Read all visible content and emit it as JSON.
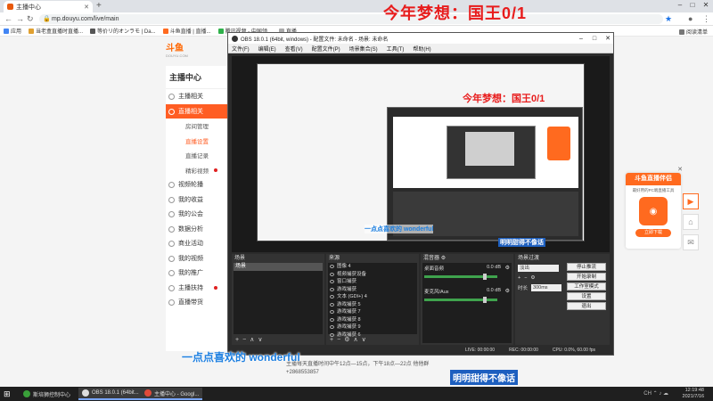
{
  "browser": {
    "tab_title": "主播中心",
    "address": "mp.douyu.com/live/main",
    "bookmarks": [
      "应用",
      "当老盒直播时直播...",
      "等价リ的オンラモ | Da...",
      "斗鱼直播 | 直播...",
      "腾讯视频 - 中国领...",
      "直播..."
    ],
    "bookmarks_right": "阅读清单"
  },
  "overlay_top": "今年梦想：国王0/1",
  "douyu": {
    "logo_text": "斗鱼",
    "logo_sub": "DOUYU.COM",
    "sidebar_title": "主播中心",
    "sidebar_items": [
      {
        "label": "主播相关",
        "type": "item"
      },
      {
        "label": "直播相关",
        "type": "active"
      },
      {
        "label": "房间管理",
        "type": "sub"
      },
      {
        "label": "直播设置",
        "type": "sub-red"
      },
      {
        "label": "直播记录",
        "type": "sub"
      },
      {
        "label": "精彩视频",
        "type": "sub-dot"
      },
      {
        "label": "视频轮播",
        "type": "item"
      },
      {
        "label": "我的收益",
        "type": "item"
      },
      {
        "label": "我的公会",
        "type": "item"
      },
      {
        "label": "数据分析",
        "type": "item"
      },
      {
        "label": "商业活动",
        "type": "item"
      },
      {
        "label": "我的视频",
        "type": "item"
      },
      {
        "label": "我的推广",
        "type": "item"
      },
      {
        "label": "主播扶持",
        "type": "item-dot"
      },
      {
        "label": "直播带货",
        "type": "item"
      }
    ],
    "bottom_text": "主播每天直播时间中午12点—15点，下午18点—22点 他他群+2868553857"
  },
  "promo": {
    "title": "斗鱼直播伴侣",
    "desc": "最好用的PC端直播工具",
    "button": "立即下载"
  },
  "obs": {
    "title": "OBS 18.0.1 (64bit, windows) - 配置文件: 未命名 - 场景: 未命名",
    "menu": [
      "文件(F)",
      "编辑(E)",
      "查看(V)",
      "配置文件(P)",
      "场景集合(S)",
      "工具(T)",
      "帮助(H)"
    ],
    "nested_overlay": "今年梦想：国王0/1",
    "nested_sub1": "一点点喜欢的 wonderful",
    "nested_sub2": "明明甜得不像话",
    "scenes_title": "场景",
    "scenes": [
      "场景"
    ],
    "sources_title": "来源",
    "sources": [
      "图像 4",
      "视频捕获设备",
      "窗口捕获",
      "游戏捕获",
      "文本 (GDI+) 4",
      "游戏捕获 5",
      "游戏捕获 7",
      "游戏捕获 8",
      "游戏捕获 9",
      "游戏捕获 6"
    ],
    "mixer_title": "混音器",
    "mixer_tracks": [
      {
        "name": "桌面音频",
        "db": "0.0 dB"
      },
      {
        "name": "麦克风/Aux",
        "db": "0.0 dB"
      }
    ],
    "transitions_title": "场景过渡",
    "transition_type": "淡出",
    "duration_label": "时长",
    "duration_value": "300ms",
    "controls": [
      "停止推流",
      "开始录制",
      "工作室模式",
      "设置",
      "退出"
    ],
    "status": {
      "live": "LIVE: 00:00:00",
      "rec": "REC: 00:00:00",
      "cpu": "CPU: 0.0%, 60.00 fps"
    }
  },
  "subtitles": {
    "left": "一点点喜欢的 wonderful",
    "right": "明明甜得不像话"
  },
  "taskbar": {
    "items": [
      "斯培狮控制中心",
      "OBS 18.0.1 (64bit...",
      "主播中心 - Googl..."
    ],
    "time": "12:19:48",
    "date": "2021/7/16",
    "lang": "CH"
  }
}
